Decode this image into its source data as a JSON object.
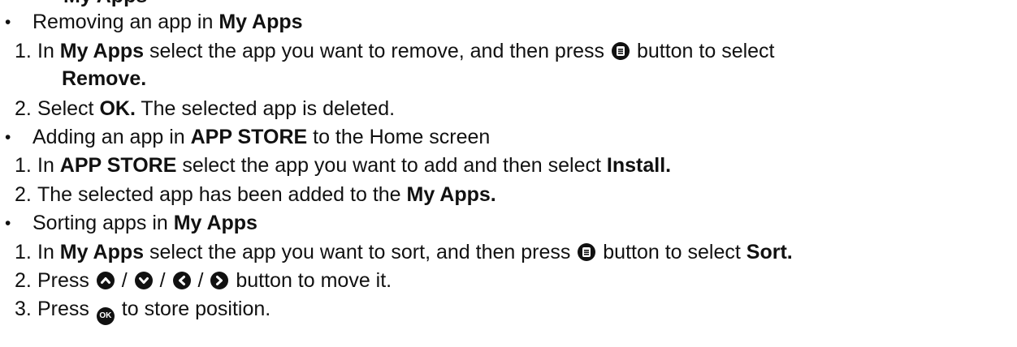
{
  "header_partial": "My Apps",
  "sections": [
    {
      "bullet": "Removing an app in ",
      "bullet_bold": "My Apps",
      "steps": [
        {
          "n": "1.",
          "a": "In ",
          "b": "My Apps",
          "c": " select the app you want to remove, and then press ",
          "d": " button to select",
          "cont": "Remove."
        },
        {
          "n": "2.",
          "a": "Select ",
          "b": "OK.",
          "c": " The selected app is deleted."
        }
      ]
    },
    {
      "bullet": "Adding an app in ",
      "bullet_bold": "APP STORE",
      "bullet_tail": " to the Home screen",
      "steps": [
        {
          "n": "1.",
          "a": "In ",
          "b": "APP STORE",
          "c": " select the app you want to add and then select ",
          "d": "Install."
        },
        {
          "n": "2.",
          "a": "The selected app has been added to the ",
          "b": "My Apps."
        }
      ]
    },
    {
      "bullet": "Sorting apps in ",
      "bullet_bold": "My Apps",
      "steps": [
        {
          "n": "1.",
          "a": "In ",
          "b": "My Apps",
          "c": " select the app you want to sort, and then press ",
          "d": " button to select ",
          "e": "Sort."
        },
        {
          "n": "2.",
          "a": "Press ",
          "sep": " / ",
          "tail": " button to move it."
        },
        {
          "n": "3.",
          "a": "Press ",
          "ok": "OK",
          "tail": " to store position."
        }
      ]
    }
  ],
  "icons": [
    "menu-icon",
    "up-icon",
    "down-icon",
    "left-icon",
    "right-icon",
    "ok-icon"
  ]
}
